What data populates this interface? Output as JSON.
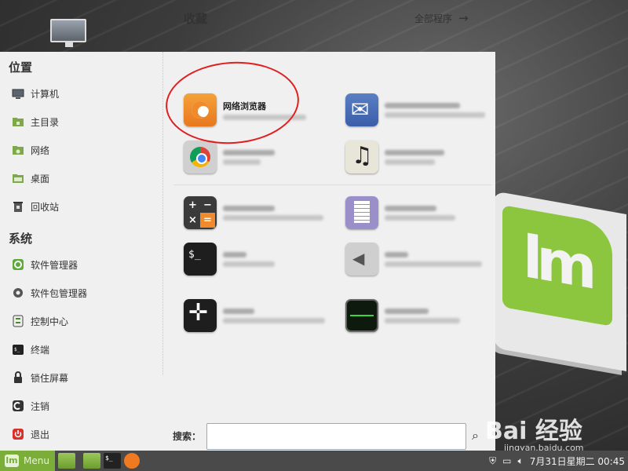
{
  "sidebar": {
    "places_title": "位置",
    "places": [
      {
        "label": "计算机",
        "icon": "computer-icon"
      },
      {
        "label": "主目录",
        "icon": "home-folder-icon"
      },
      {
        "label": "网络",
        "icon": "network-folder-icon"
      },
      {
        "label": "桌面",
        "icon": "desktop-folder-icon"
      },
      {
        "label": "回收站",
        "icon": "trash-icon"
      }
    ],
    "system_title": "系统",
    "system": [
      {
        "label": "软件管理器",
        "icon": "software-manager-icon"
      },
      {
        "label": "软件包管理器",
        "icon": "package-manager-icon"
      },
      {
        "label": "控制中心",
        "icon": "control-center-icon"
      },
      {
        "label": "终端",
        "icon": "terminal-icon"
      },
      {
        "label": "锁住屏幕",
        "icon": "lock-icon"
      },
      {
        "label": "注销",
        "icon": "logout-icon"
      },
      {
        "label": "退出",
        "icon": "power-icon"
      }
    ]
  },
  "main": {
    "favorites_title": "收藏",
    "all_programs": "全部程序",
    "apps": [
      {
        "name": "网络浏览器",
        "icon": "firefox-icon"
      },
      {
        "name": "",
        "icon": "mail-icon"
      },
      {
        "name": "",
        "icon": "chromium-icon"
      },
      {
        "name": "",
        "icon": "music-icon"
      },
      {
        "name": "",
        "icon": "calculator-icon"
      },
      {
        "name": "",
        "icon": "text-editor-icon"
      },
      {
        "name": "",
        "icon": "terminal-app-icon"
      },
      {
        "name": "",
        "icon": "sound-icon"
      },
      {
        "name": "",
        "icon": "plot-icon"
      },
      {
        "name": "",
        "icon": "system-monitor-icon"
      }
    ]
  },
  "search": {
    "label": "搜索：",
    "value": ""
  },
  "taskbar": {
    "menu_label": "Menu",
    "clock": "7月31日星期二 00:45"
  },
  "watermark": {
    "text": "Bai 经验",
    "url": "jingyan.baidu.com"
  },
  "colors": {
    "mint_green": "#8cc63f",
    "annotation_red": "#e02020",
    "taskbar": "#4a4a4a"
  }
}
